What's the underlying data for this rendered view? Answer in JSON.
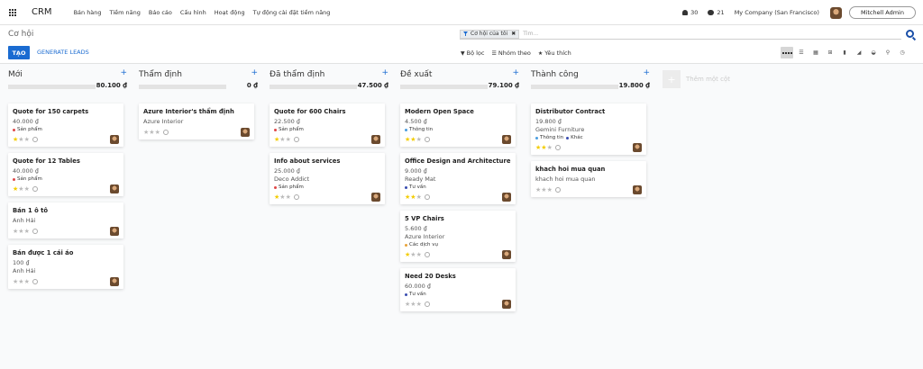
{
  "topbar": {
    "brand": "CRM",
    "menu": [
      "Bán hàng",
      "Tiềm năng",
      "Báo cáo",
      "Cấu hình",
      "Hoạt động",
      "Tự động cài đặt tiềm năng"
    ],
    "activity_count": "30",
    "message_count": "21",
    "company": "My Company (San Francisco)",
    "user": "Mitchell Admin"
  },
  "control": {
    "title": "Cơ hội",
    "create_label": "TẠO",
    "generate_label": "GENERATE LEADS",
    "facet_label": "Cơ hội của tôi",
    "search_placeholder": "Tìm...",
    "filter_label": "Bộ lọc",
    "group_label": "Nhóm theo",
    "favorite_label": "Yêu thích"
  },
  "colors": {
    "accent": "#1a6bd1",
    "star": "#f3cc00"
  },
  "add_column_label": "Thêm một cột",
  "columns": [
    {
      "title": "Mới",
      "total": "80.100 ₫",
      "cards": [
        {
          "title": "Quote for 150 carpets",
          "lines": [
            "40.000 ₫"
          ],
          "tags": [
            {
              "label": "Sản phẩm",
              "color": "#e04747"
            }
          ],
          "stars": 1
        },
        {
          "title": "Quote for 12 Tables",
          "lines": [
            "40.000 ₫"
          ],
          "tags": [
            {
              "label": "Sản phẩm",
              "color": "#e04747"
            }
          ],
          "stars": 1
        },
        {
          "title": "Bán 1 ô tô",
          "lines": [
            "Anh Hải"
          ],
          "tags": [],
          "stars": 0
        },
        {
          "title": "Bán được 1 cái áo",
          "lines": [
            "100 ₫",
            "Anh Hải"
          ],
          "tags": [],
          "stars": 0
        }
      ]
    },
    {
      "title": "Thẩm định",
      "total": "0 ₫",
      "cards": [
        {
          "title": "Azure Interior's thẩm định",
          "lines": [
            "Azure Interior"
          ],
          "tags": [],
          "stars": 0
        }
      ]
    },
    {
      "title": "Đã thẩm định",
      "total": "47.500 ₫",
      "cards": [
        {
          "title": "Quote for 600 Chairs",
          "lines": [
            "22.500 ₫"
          ],
          "tags": [
            {
              "label": "Sản phẩm",
              "color": "#e04747"
            }
          ],
          "stars": 1
        },
        {
          "title": "Info about services",
          "lines": [
            "25.000 ₫",
            "Deco Addict"
          ],
          "tags": [
            {
              "label": "Sản phẩm",
              "color": "#e04747"
            }
          ],
          "stars": 1
        }
      ]
    },
    {
      "title": "Đề xuất",
      "total": "79.100 ₫",
      "cards": [
        {
          "title": "Modern Open Space",
          "lines": [
            "4.500 ₫"
          ],
          "tags": [
            {
              "label": "Thông tin",
              "color": "#4a9de0"
            }
          ],
          "stars": 2
        },
        {
          "title": "Office Design and Architecture",
          "lines": [
            "9.000 ₫",
            "Ready Mat"
          ],
          "tags": [
            {
              "label": "Tư vấn",
              "color": "#3a4db0"
            }
          ],
          "stars": 2
        },
        {
          "title": "5 VP Chairs",
          "lines": [
            "5.600 ₫",
            "Azure Interior"
          ],
          "tags": [
            {
              "label": "Các dịch vụ",
              "color": "#e8a33a"
            }
          ],
          "stars": 1
        },
        {
          "title": "Need 20 Desks",
          "lines": [
            "60.000 ₫"
          ],
          "tags": [
            {
              "label": "Tư vấn",
              "color": "#3a4db0"
            }
          ],
          "stars": 0
        }
      ]
    },
    {
      "title": "Thành công",
      "total": "19.800 ₫",
      "cards": [
        {
          "title": "Distributor Contract",
          "lines": [
            "19.800 ₫",
            "Gemini Furniture"
          ],
          "tags": [
            {
              "label": "Thông tin",
              "color": "#4a9de0"
            },
            {
              "label": "Khác",
              "color": "#3a4db0"
            }
          ],
          "stars": 2
        },
        {
          "title": "khach hoi mua quan",
          "lines": [
            "khach hoi mua quan"
          ],
          "tags": [],
          "stars": 0
        }
      ]
    }
  ]
}
